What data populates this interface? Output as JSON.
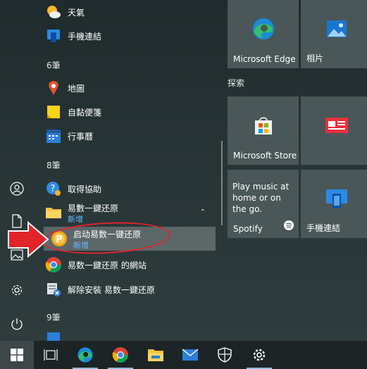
{
  "app_list": {
    "weather": "天氣",
    "phone_link": "手機連結",
    "group_6": "6筆",
    "maps": "地圖",
    "sticky_notes": "自黏便箋",
    "calendar": "行事曆",
    "group_8": "8筆",
    "get_help": "取得協助",
    "folder": {
      "label": "易數一鍵还原",
      "badge": "新增"
    },
    "launch_app": {
      "label": "启动易数一键还原",
      "badge": "新增"
    },
    "website": "易数一鍵还原 的網站",
    "uninstall": "解除安裝 易数一鍵还原",
    "group_9": "9筆"
  },
  "tiles": {
    "edge": "Microsoft Edge",
    "photos": "相片",
    "group_explore": "探索",
    "store": "Microsoft Store",
    "spotify_text": "Play music at home or on the go.",
    "spotify": "Spotify",
    "phone_link": "手機連結"
  },
  "taskbar": {
    "items": [
      "start-icon",
      "task-view-icon",
      "edge-icon",
      "chrome-icon",
      "file-explorer-icon",
      "mail-icon",
      "security-icon",
      "settings-icon"
    ]
  },
  "colors": {
    "accent_blue": "#69b8ff",
    "annotation_red": "#e0242a",
    "tile_bg": "#4a5758"
  }
}
